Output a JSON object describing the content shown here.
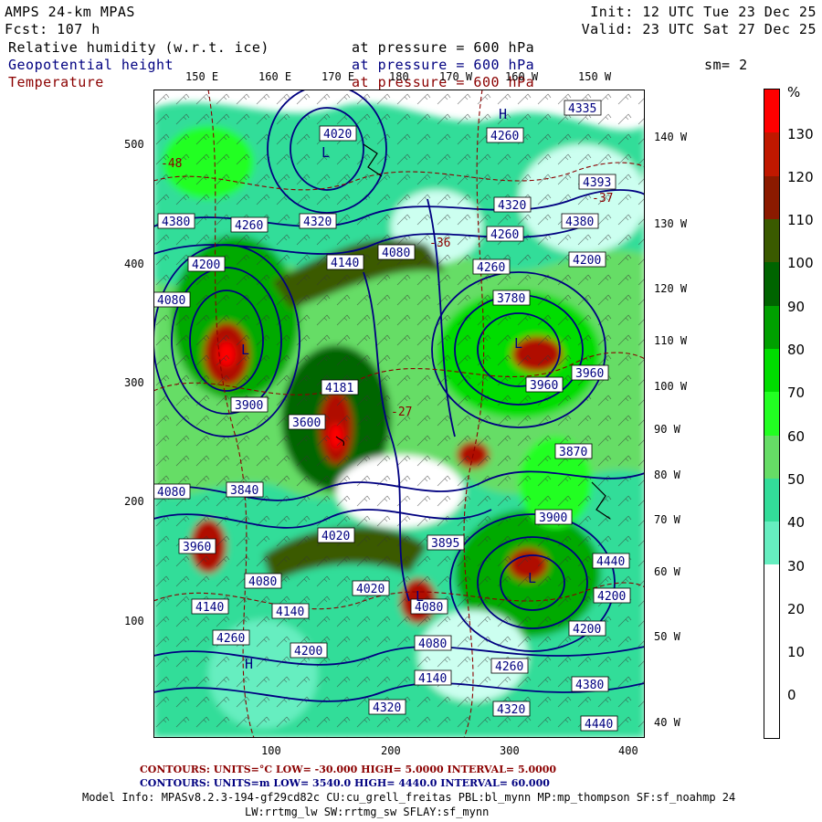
{
  "header": {
    "model": "AMPS 24-km MPAS",
    "fcst": "Fcst:  107 h",
    "init": "Init: 12 UTC Tue 23 Dec 25",
    "valid": "Valid: 23 UTC Sat 27 Dec 25",
    "field1_name": "Relative humidity (w.r.t. ice)",
    "field1_level": "at pressure =  600 hPa",
    "field2_name": "Geopotential height",
    "field2_level": "at pressure =  600 hPa",
    "field3_name": "Temperature",
    "field3_level": "at pressure =  600 hPa",
    "smooth": "sm= 2"
  },
  "colors": {
    "temperature": "#8b0000",
    "height": "#000080",
    "rh_30": "#ccfff0",
    "rh_40": "#66eec0",
    "rh_50": "#33dd99",
    "rh_60": "#66dd66",
    "rh_70": "#22ff22",
    "rh_80": "#00dd00",
    "rh_90": "#00aa00",
    "rh_100": "#006600",
    "rh_110": "#3a5a00",
    "rh_120": "#b01000",
    "rh_130": "#ff0000"
  },
  "top_lon_labels": [
    "150 E",
    "160 E",
    "170 E",
    "180",
    "170 W",
    "160 W",
    "150 W"
  ],
  "right_lon_labels": [
    "140 W",
    "130 W",
    "120 W",
    "110 W",
    "100 W",
    "90 W",
    "80 W",
    "70 W",
    "60 W",
    "50 W",
    "40 W"
  ],
  "left_axis_labels": [
    "500",
    "400",
    "300",
    "200",
    "100"
  ],
  "bottom_axis_labels": [
    "100",
    "200",
    "300",
    "400"
  ],
  "colorbar": {
    "unit": "%",
    "labels": [
      "130",
      "120",
      "110",
      "100",
      "90",
      "80",
      "70",
      "60",
      "50",
      "40",
      "30",
      "20",
      "10",
      "0"
    ]
  },
  "height_labels": [
    "4335",
    "4260",
    "4393",
    "4320",
    "4380",
    "4200",
    "4380",
    "4260",
    "4320",
    "4260",
    "4140",
    "4200",
    "4260",
    "3780",
    "4080",
    "3960",
    "3900",
    "3840",
    "3870",
    "4020",
    "3960",
    "3900",
    "3895",
    "4080",
    "4140",
    "4440",
    "4200",
    "4200",
    "4260",
    "4380",
    "4440",
    "4320",
    "4320",
    "4140",
    "4080",
    "4020",
    "4080",
    "4140",
    "4260",
    "4200",
    "4080",
    "4020",
    "3960",
    "3600",
    "4181",
    "4080"
  ],
  "temp_labels": [
    "-48",
    "-37",
    "-27",
    "-36"
  ],
  "footer": {
    "temp_line": "CONTOURS:  UNITS=°C  LOW=  -30.000          HIGH=  5.0000        INTERVAL=   5.0000",
    "height_line": "CONTOURS:  UNITS=m   LOW=   3540.0          HIGH=  4440.0        INTERVAL=   60.000",
    "model_info": "Model Info: MPASv8.2.3-194-gf29cd82c CU:cu_grell_freitas PBL:bl_mynn MP:mp_thompson SF:sf_noahmp 24",
    "model_info2": "LW:rrtmg_lw SW:rrtmg_sw SFLAY:sf_mynn"
  }
}
